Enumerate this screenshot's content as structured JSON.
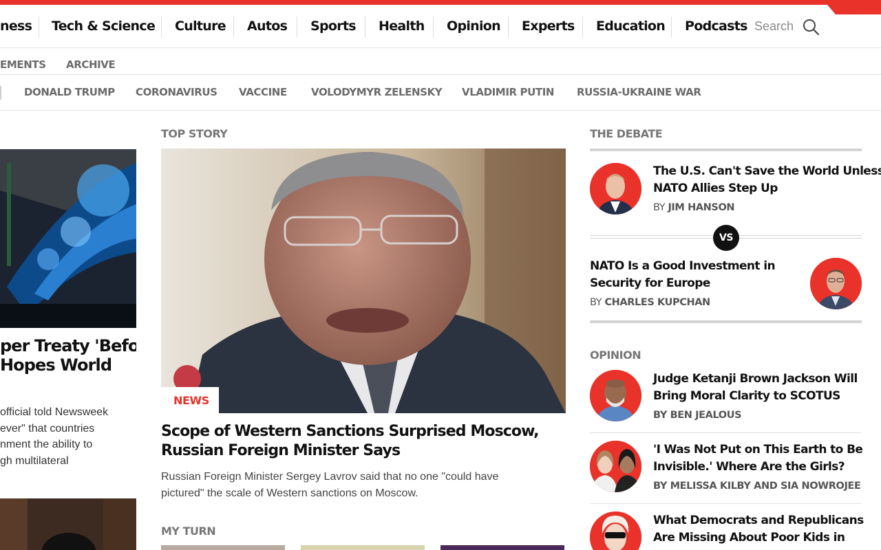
{
  "nav": {
    "items": [
      "ness",
      "Tech & Science",
      "Culture",
      "Autos",
      "Sports",
      "Health",
      "Opinion",
      "Experts",
      "Education",
      "Podcasts"
    ],
    "search_label": "Search"
  },
  "subnav": {
    "items": [
      "EMENTS",
      "ARCHIVE"
    ]
  },
  "trending": {
    "items": [
      "DONALD TRUMP",
      "CORONAVIRUS",
      "VACCINE",
      "VOLODYMYR ZELENSKY",
      "VLADIMIR PUTIN",
      "RUSSIA-UKRAINE WAR"
    ]
  },
  "left": {
    "title_lines": [
      "per Treaty 'Before",
      "Hopes World"
    ],
    "summary_lines": [
      "official told Newsweek",
      "ever\" that countries",
      "nment the ability to",
      "gh multilateral"
    ]
  },
  "center": {
    "section_label": "TOP STORY",
    "tag": "NEWS",
    "title_lines": [
      "Scope of Western Sanctions Surprised Moscow,",
      "Russian Foreign Minister Says"
    ],
    "summary_lines": [
      "Russian Foreign Minister Sergey Lavrov said that no one \"could have",
      "pictured\" the scale of Western sanctions on Moscow."
    ],
    "myturn_label": "MY TURN"
  },
  "debate": {
    "section_label": "THE DEBATE",
    "vs_label": "VS",
    "items": [
      {
        "title_lines": [
          "The U.S. Can't Save the World Unless",
          "NATO Allies Step Up"
        ],
        "by": "BY",
        "author": "JIM HANSON"
      },
      {
        "title_lines": [
          "NATO Is a Good Investment in",
          "Security for Europe"
        ],
        "by": "BY",
        "author": "CHARLES KUPCHAN"
      }
    ]
  },
  "opinion": {
    "section_label": "OPINION",
    "items": [
      {
        "title_lines": [
          "Judge Ketanji Brown Jackson Will",
          "Bring Moral Clarity to SCOTUS"
        ],
        "byline": "BY BEN JEALOUS"
      },
      {
        "title_lines": [
          "'I Was Not Put on This Earth to Be",
          "Invisible.' Where Are the Girls?"
        ],
        "byline": "BY MELISSA KILBY AND SIA NOWROJEE"
      },
      {
        "title_lines": [
          "What Democrats and Republicans",
          "Are Missing About Poor Kids in"
        ],
        "byline": ""
      }
    ]
  },
  "colors": {
    "brand_red": "#e8322a",
    "nav_text": "#111111",
    "muted": "#777777"
  }
}
